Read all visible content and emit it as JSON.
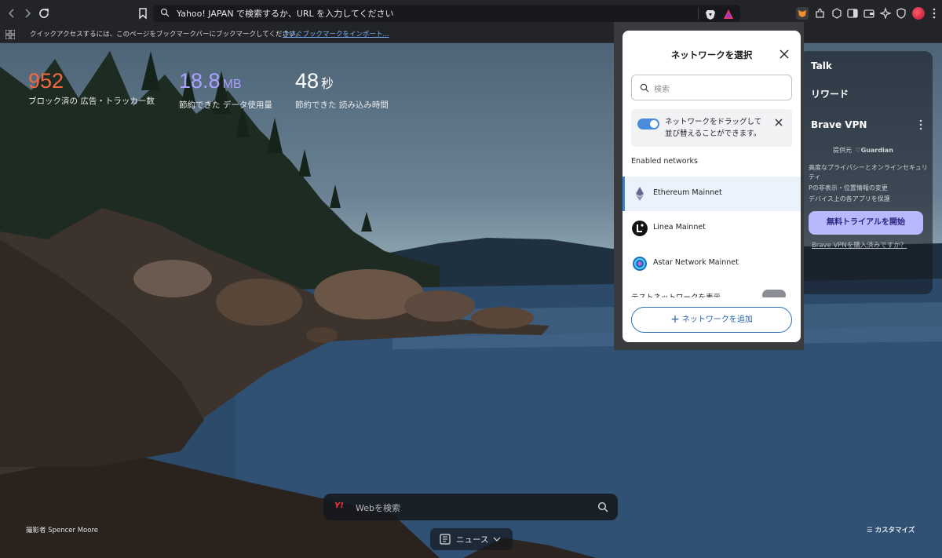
{
  "toolbar": {
    "back_icon": "chevron-left-icon",
    "forward_icon": "chevron-right-icon",
    "reload_icon": "reload-icon",
    "bookmark_icon": "bookmark-icon",
    "url_placeholder": "Yahoo! JAPAN で検索するか、URL を入力してください"
  },
  "bookmarks_bar": {
    "message": "クイックアクセスするには、このページをブックマークバーにブックマークしてください。",
    "import_link": "今すぐブックマークをインポート..."
  },
  "stats": {
    "blocked": {
      "value": "952",
      "label": "ブロック済の 広告・トラッカー数",
      "color": "#f36a42"
    },
    "data_saved": {
      "value": "18.8",
      "unit": "MB",
      "label": "節約できた データ使用量",
      "color": "#a9a0ff"
    },
    "time_saved": {
      "value": "48",
      "unit": "秒",
      "label": "節約できた 読み込み時間",
      "color": "#ffffff"
    }
  },
  "widgets": {
    "talk": "Talk",
    "rewards": "リワード",
    "vpn_title": "Brave VPN",
    "provider": "提供元",
    "provider_name": "Guardian",
    "bullet1a": "高度なプライバシーとオンラインセキュリ",
    "bullet1b": "ティ",
    "bullet2": "Pの非表示・位置情報の変更",
    "bullet3": "デバイス上の各アプリを保護",
    "trial_button": "無料トライアルを開始",
    "purchased_link": "Brave VPNを購入済みですか？"
  },
  "wallet_popup": {
    "title": "ネットワークを選択",
    "search_placeholder": "検索",
    "note_line1": "ネットワークをドラッグして",
    "note_line2": "並び替えることができます。",
    "section_label": "Enabled networks",
    "networks": [
      {
        "name": "Ethereum Mainnet",
        "selected": true
      },
      {
        "name": "Linea Mainnet",
        "selected": false
      },
      {
        "name": "Astar Network Mainnet",
        "selected": false
      }
    ],
    "show_test_networks": "テストネットワークを表示",
    "add_network_button": "ネットワークを追加"
  },
  "search": {
    "engine_logo": "Y!",
    "placeholder": "Webを検索"
  },
  "news": {
    "label": "ニュース"
  },
  "photo_credit": "撮影者 Spencer Moore",
  "customize": "カスタマイズ"
}
